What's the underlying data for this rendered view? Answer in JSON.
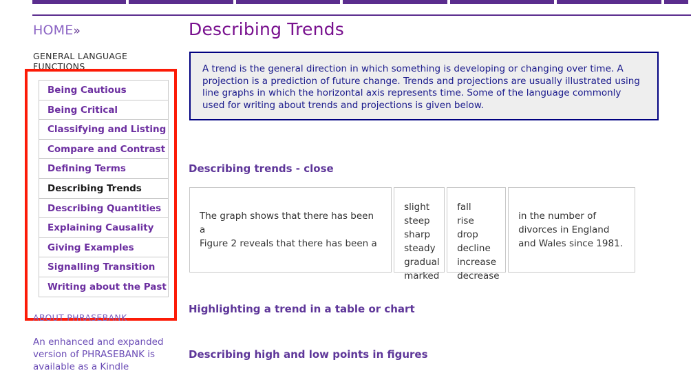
{
  "topnav": {
    "segments": [
      {
        "name": "nav-segment-1",
        "width": 139
      },
      {
        "name": "nav-segment-2",
        "width": 155
      },
      {
        "name": "nav-segment-3",
        "width": 155
      },
      {
        "name": "nav-segment-4",
        "width": 155
      },
      {
        "name": "nav-segment-5",
        "width": 155
      },
      {
        "name": "nav-segment-6",
        "width": 155
      },
      {
        "name": "nav-segment-7",
        "width": 36
      }
    ],
    "accent_color": "#5b2d8e"
  },
  "sidebar": {
    "breadcrumb": {
      "home_label": "HOME",
      "chevron": "»"
    },
    "section_label": "GENERAL LANGUAGE FUNCTIONS",
    "highlight_color": "#fc1b07",
    "items": [
      {
        "label": "Being Cautious",
        "current": false
      },
      {
        "label": "Being Critical",
        "current": false
      },
      {
        "label": "Classifying and Listing",
        "current": false
      },
      {
        "label": "Compare and Contrast",
        "current": false
      },
      {
        "label": "Defining Terms",
        "current": false
      },
      {
        "label": "Describing Trends",
        "current": true
      },
      {
        "label": "Describing Quantities",
        "current": false
      },
      {
        "label": "Explaining Causality",
        "current": false
      },
      {
        "label": "Giving Examples",
        "current": false
      },
      {
        "label": "Signalling Transition",
        "current": false
      },
      {
        "label": "Writing about the Past",
        "current": false
      }
    ],
    "about_label": "ABOUT PHRASEBANK",
    "about_text": "An enhanced and expanded version of PHRASEBANK is available as a Kindle"
  },
  "main": {
    "page_title": "Describing Trends",
    "intro_box": {
      "text": "A trend is the general direction in which something is developing or changing over time. A projection is a prediction of future change. Trends and projections are usually illustrated using line graphs in which the horizontal axis represents time. Some of the language commonly used for writing about trends and projections is given below.",
      "background": "#eeeeee",
      "border_color": "#000080",
      "text_color": "#1a1a8c"
    },
    "sections": [
      {
        "heading": "Describing trends - close"
      },
      {
        "heading": "Highlighting a trend in a table or chart"
      },
      {
        "heading": "Describing high and low points in figures"
      }
    ],
    "phrase_table": {
      "sentences": "The graph shows that there has been a\nFigure 2  reveals that there has been a",
      "adjectives": "slight\nsteep\nsharp\nsteady\ngradual\nmarked",
      "nouns": "fall\nrise\ndrop\ndecline\nincrease\ndecrease",
      "tail": "in the number of divorces in England and Wales since 1981."
    }
  }
}
